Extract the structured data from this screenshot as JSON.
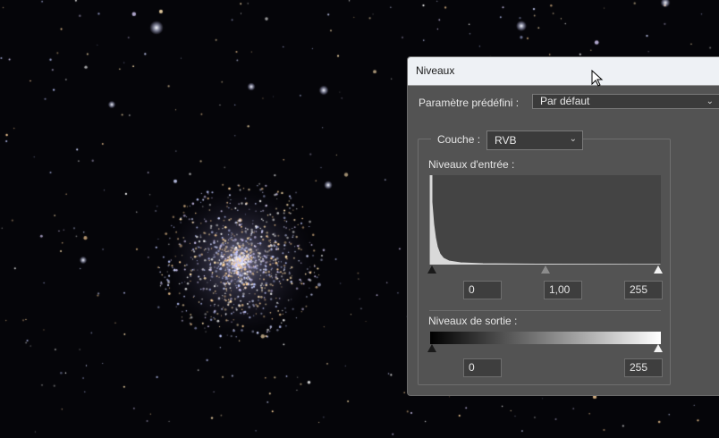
{
  "dialog": {
    "title": "Niveaux",
    "preset_label": "Paramètre prédéfini :",
    "preset_value": "Par défaut",
    "channel_label": "Couche :",
    "channel_value": "RVB",
    "input_levels_label": "Niveaux d'entrée :",
    "input_black": "0",
    "input_gamma": "1,00",
    "input_white": "255",
    "output_levels_label": "Niveaux de sortie :",
    "output_black": "0",
    "output_white": "255"
  },
  "icons": {
    "chevron": "chevron-down-icon",
    "cursor": "mouse-pointer-icon"
  },
  "colors": {
    "dialog_bg": "#535353",
    "titlebar_bg": "#eef1f5",
    "histogram_bg": "#444444"
  }
}
